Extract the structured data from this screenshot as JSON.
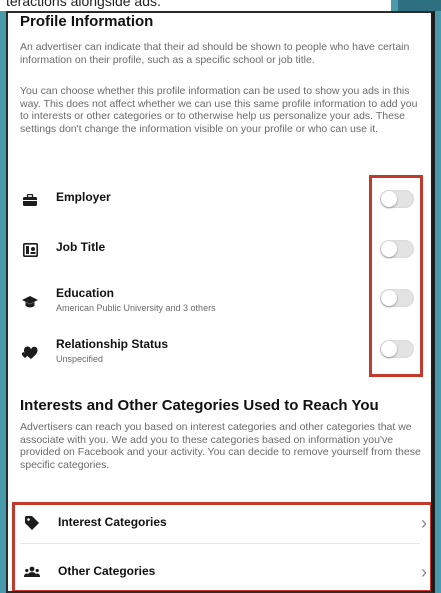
{
  "top_strip_text": "teractions alongside ads.",
  "profile": {
    "title": "Profile Information",
    "para1": "An advertiser can indicate that their ad should be shown to people who have certain information on their profile, such as a specific school or job title.",
    "para2": "You can choose whether this profile information can be used to show you ads in this way. This does not affect whether we can use this same profile information to add you to interests or other categories or to otherwise help us personalize your ads. These settings don't change the information visible on your profile or who can use it.",
    "items": [
      {
        "label": "Employer",
        "sub": "",
        "icon": "briefcase-icon",
        "enabled": false
      },
      {
        "label": "Job Title",
        "sub": "",
        "icon": "id-badge-icon",
        "enabled": false
      },
      {
        "label": "Education",
        "sub": "American Public University and 3 others",
        "icon": "graduation-cap-icon",
        "enabled": false
      },
      {
        "label": "Relationship Status",
        "sub": "Unspecified",
        "icon": "hearts-icon",
        "enabled": false
      }
    ]
  },
  "interests": {
    "title": "Interests and Other Categories Used to Reach You",
    "para": "Advertisers can reach you based on interest categories and other categories that we associate with you. We add you to these categories based on information you've provided on Facebook and your activity. You can decide to remove yourself from these specific categories.",
    "items": [
      {
        "label": "Interest Categories",
        "icon": "tag-icon"
      },
      {
        "label": "Other Categories",
        "icon": "people-icon"
      }
    ]
  },
  "colors": {
    "background": "#4a9aad",
    "highlight": "#c23a2b",
    "toggle_off": "#e3e3e3"
  }
}
